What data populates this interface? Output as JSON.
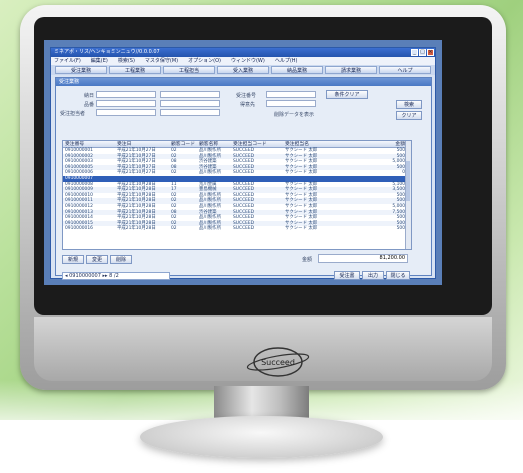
{
  "window": {
    "title": "ミネアポ・リス/ヘンキョミンニュウ//0.0.0.07"
  },
  "menu": [
    "ファイル(F)",
    "編集(E)",
    "検索(S)",
    "マスタ保守(M)",
    "オプション(O)",
    "ウィンドウ(W)",
    "ヘルプ(H)"
  ],
  "tabs": [
    "受注業務",
    "工程業務",
    "工程担当",
    "受入業務",
    "納品業務",
    "請求業務",
    "ヘルプ"
  ],
  "subwindow": {
    "title": "受注業務"
  },
  "filters": {
    "labels": [
      "納日",
      "品番",
      "受注担当者",
      "受注番号",
      "得意先"
    ],
    "condition_clear": "条件クリア",
    "show_deleted": "削除データを表示",
    "search": "検索",
    "clear": "クリア"
  },
  "grid": {
    "headers": [
      "受注番号",
      "受注日",
      "顧客コード",
      "顧客名称",
      "受注担当コード",
      "受注担当名",
      "金額"
    ],
    "rows": [
      [
        "0910000001",
        "平成21年10月27日",
        "02",
        "品川製作所",
        "SUCCEED",
        "サクシード 太郎",
        "500"
      ],
      [
        "0910000002",
        "平成21年10月27日",
        "02",
        "品川製作所",
        "SUCCEED",
        "サクシード 太郎",
        "500"
      ],
      [
        "0910000003",
        "平成21年10月27日",
        "08",
        "渋谷建築",
        "SUCCEED",
        "サクシード 太郎",
        "5,000"
      ],
      [
        "0910000005",
        "平成21年10月27日",
        "08",
        "渋谷建築",
        "SUCCEED",
        "サクシード 太郎",
        "500"
      ],
      [
        "0910000006",
        "平成21年10月27日",
        "02",
        "品川製作所",
        "SUCCEED",
        "サクシード 太郎",
        "0"
      ],
      [
        "0910000007",
        "",
        "",
        "",
        "",
        "",
        ""
      ],
      [
        "0910000008",
        "平成21年10月28日",
        "11",
        "荒川金属",
        "SUCCEED",
        "サクシード 太郎",
        "5,100"
      ],
      [
        "0910000009",
        "平成21年10月28日",
        "17",
        "豊島機械",
        "SUCCEED",
        "サクシード 太郎",
        "3,500"
      ],
      [
        "0910000010",
        "平成21年10月28日",
        "02",
        "品川製作所",
        "SUCCEED",
        "サクシード 太郎",
        "500"
      ],
      [
        "0910000011",
        "平成21年10月28日",
        "02",
        "品川製作所",
        "SUCCEED",
        "サクシード 太郎",
        "500"
      ],
      [
        "0910000012",
        "平成21年10月28日",
        "02",
        "品川製作所",
        "SUCCEED",
        "サクシード 太郎",
        "5,000"
      ],
      [
        "0910000013",
        "平成21年10月28日",
        "08",
        "渋谷建築",
        "SUCCEED",
        "サクシード 太郎",
        "7,500"
      ],
      [
        "0910000014",
        "平成21年10月28日",
        "02",
        "品川製作所",
        "SUCCEED",
        "サクシード 太郎",
        "500"
      ],
      [
        "0910000015",
        "平成21年10月28日",
        "02",
        "品川製作所",
        "SUCCEED",
        "サクシード 太郎",
        "500"
      ],
      [
        "0910000016",
        "平成21年10月28日",
        "02",
        "品川製作所",
        "SUCCEED",
        "サクシード 太郎",
        "500"
      ]
    ]
  },
  "actions": {
    "new": "新規",
    "edit": "変更",
    "delete": "削除"
  },
  "total": {
    "label": "金額",
    "value": "81,200.00"
  },
  "nav": {
    "record": "0910000007",
    "page": "8",
    "of": "/2"
  },
  "footer": {
    "issue": "受注書",
    "print": "出力",
    "close": "閉じる"
  },
  "brand": {
    "logo": "Succeed"
  },
  "colors": {
    "titlebar": "#2453ad",
    "selection": "#2f5fb8",
    "desktop": "#5a7fb8"
  }
}
